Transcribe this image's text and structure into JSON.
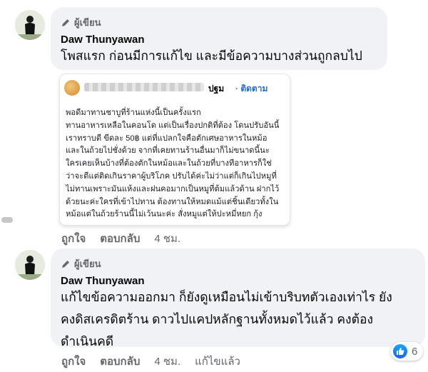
{
  "comments": [
    {
      "badge": "ผู้เขียน",
      "author": "Daw Thunyawan",
      "lines": [
        "โพสแรก ก่อนมีการแก้ไข และมีข้อความบางส่วนถูกลบไป"
      ],
      "actions": {
        "like": "ถูกใจ",
        "reply": "ตอบกลับ",
        "time": "4 ชม."
      },
      "attachment": {
        "page_name_tail": "ปฐม",
        "follow": "· ติดตาม",
        "body": "พอดีมาทานชาบูที่ร้านแห่งนี้เป็นครั้งแรก\nทานอาหารเหลือในคอนโด แต่เป็นเรื่องปกติที่ต้อง โดนปรับอันนี้\nเราทราบดี ขีดละ 50฿ แต่ที่แปลกใจคือตักเศษอาหารในหม้อ\nและในถ้วยไปชั่งด้วย จากที่เคยทานร้านอื่นมาก็ไม่ขนาดนี้นะ\nใครเคยเห็นบ้างที่ต้องตักในหม้อและในถ้วยที่บางทีอาหารก็ใช่\nว่าจะตีแต่ติดเกินราคาผู้บริโภค ปรับได้ค่ะไม่ว่าแต่ก็เกินไปหมูที่\nไม่ทานเพราะมันแห้งและฝนคอมากเป็นหมูที่ต้มแล้วด้าน ฝากไว้\nด้วยนะค่ะใครที่เข้าไปทาน ต้องทานให้หมดแม้แต่ชิ้นเดียวทั้งใน\nหม้อแต่ในถ้วยร้านนี้ไม่เว้นนะค่ะ สั่งหมูแต่ให้ปะหมี่หยก กุ้ง"
      }
    },
    {
      "badge": "ผู้เขียน",
      "author": "Daw Thunyawan",
      "lines": [
        "แก้ไขข้อความออกมา ก็ยังดูเหมือนไม่เข้าบริบทตัวเองเท่าไร ยัง",
        "คงดิสเครดิตร้าน ดาวไปแคปหลักฐานทั้งหมดไว้แล้ว คงต้อง",
        "ดำเนินคดี"
      ],
      "actions": {
        "like": "ถูกใจ",
        "reply": "ตอบกลับ",
        "time": "4 ชม.",
        "edited": "แก้ไขแล้ว"
      },
      "reactions": {
        "icon": "thumbs-up-icon",
        "count": "6",
        "color": "#1877f2"
      }
    }
  ]
}
